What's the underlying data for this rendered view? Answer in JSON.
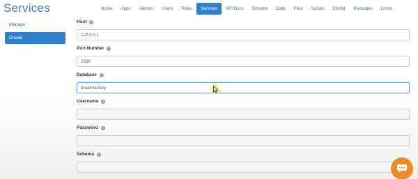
{
  "header": {
    "title": "Services"
  },
  "nav": {
    "items": [
      {
        "label": "Home"
      },
      {
        "label": "Apps"
      },
      {
        "label": "Admins"
      },
      {
        "label": "Users"
      },
      {
        "label": "Roles"
      },
      {
        "label": "Services"
      },
      {
        "label": "API Docs"
      },
      {
        "label": "Schema"
      },
      {
        "label": "Data"
      },
      {
        "label": "Files"
      },
      {
        "label": "Scripts"
      },
      {
        "label": "Config"
      },
      {
        "label": "Packages"
      },
      {
        "label": "Limits"
      }
    ],
    "active": "Services"
  },
  "sidebar": {
    "items": [
      {
        "label": "Manage"
      },
      {
        "label": "Create"
      }
    ],
    "active": "Create"
  },
  "form": {
    "fields": [
      {
        "label": "Host",
        "value": "127.0.0.1"
      },
      {
        "label": "Port Number",
        "value": "3306"
      },
      {
        "label": "Database",
        "value": "dreamfactory"
      },
      {
        "label": "Username",
        "value": ""
      },
      {
        "label": "Password",
        "value": ""
      },
      {
        "label": "Schema",
        "value": ""
      }
    ]
  },
  "icons": {
    "info": "info-icon",
    "chat": "chat-icon",
    "cursor": "mouse-cursor-icon"
  },
  "colors": {
    "accent": "#2f7fcc",
    "title": "#4a78a5",
    "chat": "#f08a24"
  }
}
